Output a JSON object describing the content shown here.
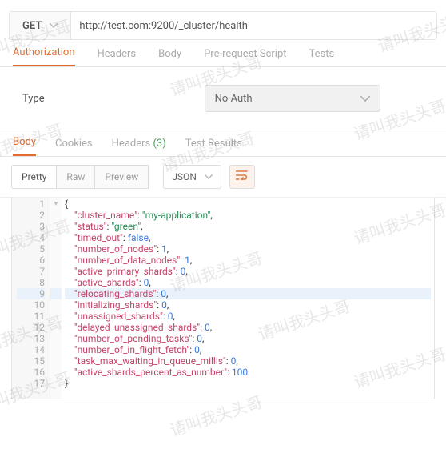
{
  "request": {
    "method": "GET",
    "url": "http://test.com:9200/_cluster/health"
  },
  "tabsTop": {
    "authorization": "Authorization",
    "headers": "Headers",
    "body": "Body",
    "prerequest": "Pre-request Script",
    "tests": "Tests"
  },
  "auth": {
    "typeLabel": "Type",
    "selected": "No Auth"
  },
  "tabsResp": {
    "body": "Body",
    "cookies": "Cookies",
    "headers": "Headers",
    "headersCount": "(3)",
    "testResults": "Test Results"
  },
  "viewer": {
    "pretty": "Pretty",
    "raw": "Raw",
    "preview": "Preview",
    "format": "JSON"
  },
  "code": {
    "lines": [
      {
        "n": 1,
        "html": "{"
      },
      {
        "n": 2,
        "html": "    <span class=\"k\">\"cluster_name\"</span>: <span class=\"s\">\"my-application\"</span>,"
      },
      {
        "n": 3,
        "html": "    <span class=\"k\">\"status\"</span>: <span class=\"s\">\"green\"</span>,"
      },
      {
        "n": 4,
        "html": "    <span class=\"k\">\"timed_out\"</span>: <span class=\"n\">false</span>,"
      },
      {
        "n": 5,
        "html": "    <span class=\"k\">\"number_of_nodes\"</span>: <span class=\"n\">1</span>,"
      },
      {
        "n": 6,
        "html": "    <span class=\"k\">\"number_of_data_nodes\"</span>: <span class=\"n\">1</span>,"
      },
      {
        "n": 7,
        "html": "    <span class=\"k\">\"active_primary_shards\"</span>: <span class=\"n\">0</span>,"
      },
      {
        "n": 8,
        "html": "    <span class=\"k\">\"active_shards\"</span>: <span class=\"n\">0</span>,"
      },
      {
        "n": 9,
        "html": "    <span class=\"k\">\"relocating_shards\"</span>: <span class=\"n\">0</span>,",
        "hl": true
      },
      {
        "n": 10,
        "html": "    <span class=\"k\">\"initializing_shards\"</span>: <span class=\"n\">0</span>,"
      },
      {
        "n": 11,
        "html": "    <span class=\"k\">\"unassigned_shards\"</span>: <span class=\"n\">0</span>,"
      },
      {
        "n": 12,
        "html": "    <span class=\"k\">\"delayed_unassigned_shards\"</span>: <span class=\"n\">0</span>,"
      },
      {
        "n": 13,
        "html": "    <span class=\"k\">\"number_of_pending_tasks\"</span>: <span class=\"n\">0</span>,"
      },
      {
        "n": 14,
        "html": "    <span class=\"k\">\"number_of_in_flight_fetch\"</span>: <span class=\"n\">0</span>,"
      },
      {
        "n": 15,
        "html": "    <span class=\"k\">\"task_max_waiting_in_queue_millis\"</span>: <span class=\"n\">0</span>,"
      },
      {
        "n": 16,
        "html": "    <span class=\"k\">\"active_shards_percent_as_number\"</span>: <span class=\"n\">100</span>"
      },
      {
        "n": 17,
        "html": "}"
      }
    ]
  },
  "watermark": "请叫我头头哥"
}
